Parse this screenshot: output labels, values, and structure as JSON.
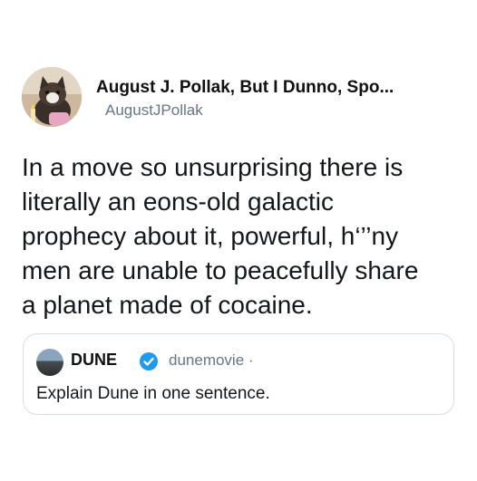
{
  "tweet": {
    "author": {
      "display_name": "August J. Pollak, But I Dunno, Spo...",
      "handle": "AugustJPollak",
      "avatar_icon": "cat-avatar-icon"
    },
    "text": "In a move so unsurprising there is\nliterally an eons-old galactic\nprophecy about it, powerful, h‘’’ny\nmen are unable to peacefully share\na planet made of cocaine."
  },
  "quoted_tweet": {
    "author": {
      "display_name": "DUNE",
      "handle": "dunemovie ·",
      "verified": true,
      "avatar_icon": "dune-avatar-icon"
    },
    "text": "Explain Dune in one sentence."
  },
  "colors": {
    "text_primary": "#14171a",
    "text_secondary": "#657786",
    "verified_blue": "#1d9bf0",
    "card_border": "#d6dde3"
  }
}
